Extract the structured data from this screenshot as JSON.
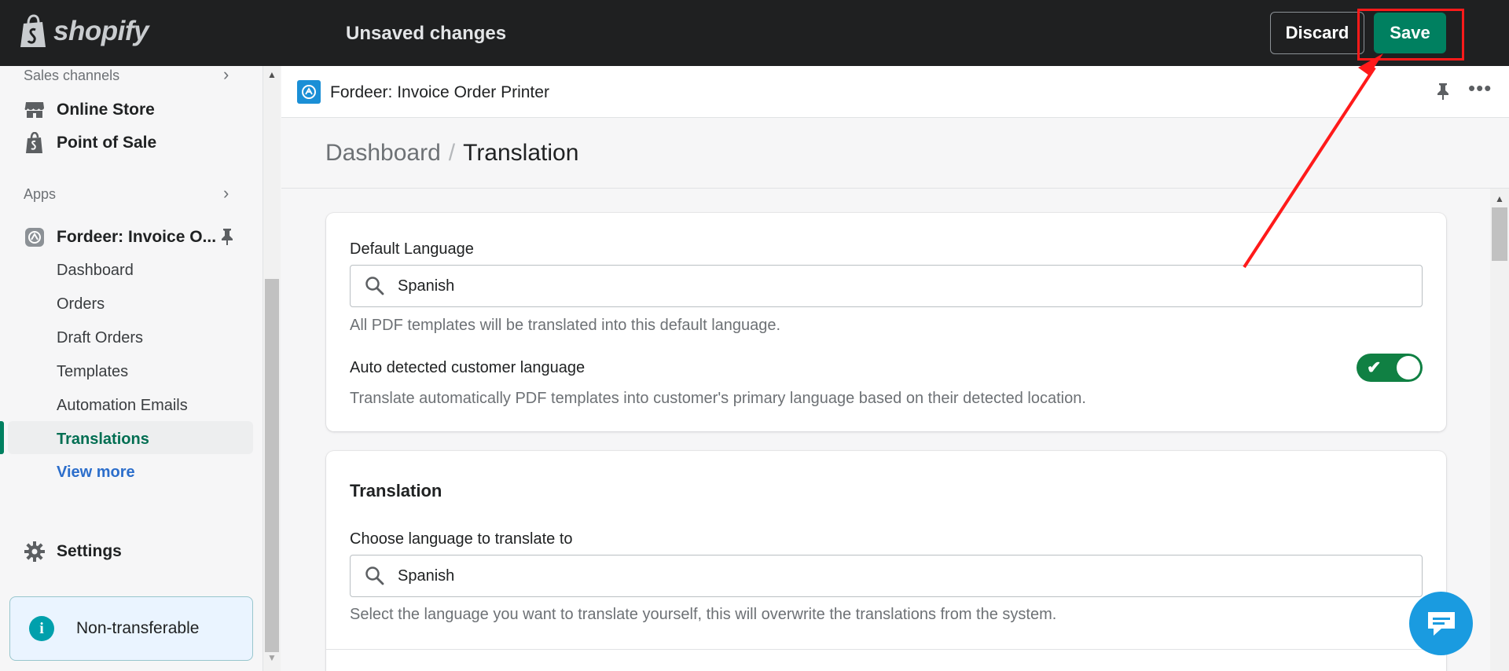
{
  "topbar": {
    "logo_text": "shopify",
    "status": "Unsaved changes",
    "discard_label": "Discard",
    "save_label": "Save"
  },
  "sidebar": {
    "sales_channels_label": "Sales channels",
    "channels": [
      {
        "label": "Online Store",
        "icon": "store-icon"
      },
      {
        "label": "Point of Sale",
        "icon": "pos-bag-icon"
      }
    ],
    "apps_label": "Apps",
    "app_name": "Fordeer: Invoice O...",
    "sub_items": [
      "Dashboard",
      "Orders",
      "Draft Orders",
      "Templates",
      "Automation Emails",
      "Translations"
    ],
    "active_item": "Translations",
    "view_more": "View more",
    "settings_label": "Settings",
    "notice": "Non-transferable"
  },
  "app_header": {
    "title": "Fordeer: Invoice Order Printer"
  },
  "breadcrumb": {
    "parent": "Dashboard",
    "separator": "/",
    "current": "Translation"
  },
  "default_language_card": {
    "label": "Default Language",
    "value": "Spanish",
    "help": "All PDF templates will be translated into this default language.",
    "auto_detect_label": "Auto detected customer language",
    "auto_detect_enabled": true,
    "auto_detect_help": "Translate automatically PDF templates into customer's primary language based on their detected location."
  },
  "translation_card": {
    "title": "Translation",
    "label": "Choose language to translate to",
    "value": "Spanish",
    "help": "Select the language you want to translate yourself, this will overwrite the translations from the system."
  },
  "colors": {
    "topbar": "#1f2021",
    "primary": "#008060",
    "toggle_on": "#108043",
    "link": "#2c6ecb",
    "annotation": "#ff1a1a",
    "chat": "#1a9be0"
  }
}
